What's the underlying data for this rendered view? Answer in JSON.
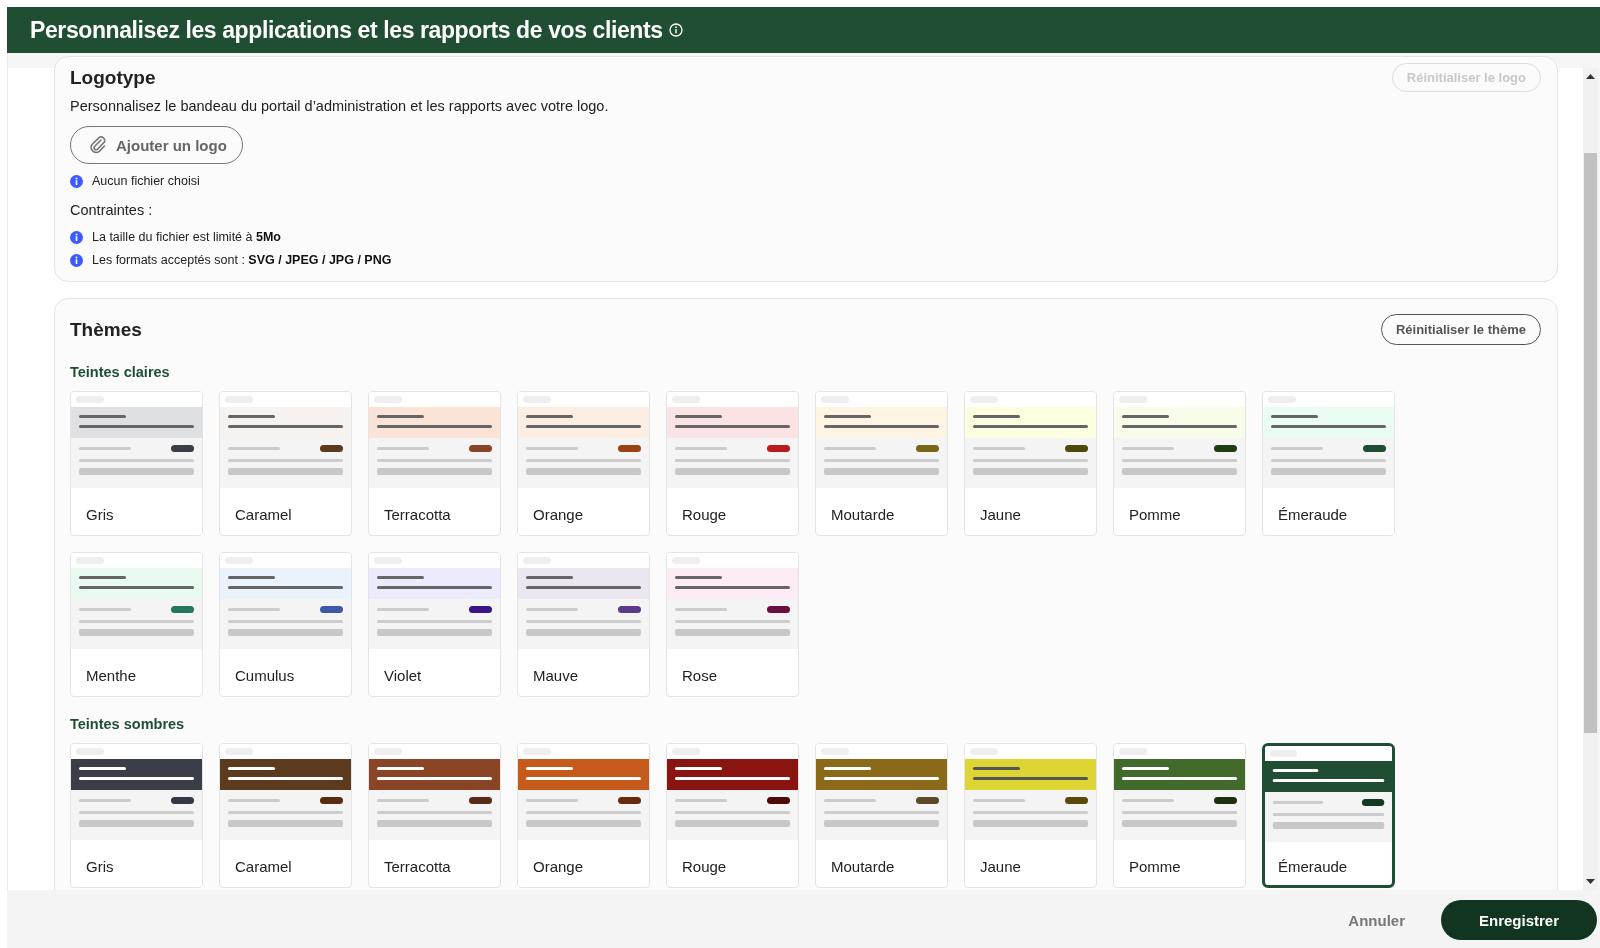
{
  "header": {
    "title": "Personnalisez les applications et les rapports de vos clients"
  },
  "logo_section": {
    "title": "Logotype",
    "reset_button": {
      "label": "Réinitialiser le logo",
      "disabled": true
    },
    "description": "Personnalisez le bandeau du portail d’administration et les rapports avec votre logo.",
    "add_button": {
      "label": "Ajouter un logo"
    },
    "file_status": "Aucun fichier choisi",
    "constraints_label": "Contraintes :",
    "constraints": [
      "La taille du fichier est limité à **5Mo**",
      "Les formats acceptés sont : **SVG / JPEG / JPG / PNG**"
    ]
  },
  "themes": {
    "title": "Thèmes",
    "reset_button": {
      "label": "Réinitialiser le thème",
      "disabled": false
    },
    "groups": [
      {
        "title": "Teintes claires",
        "kind": "light",
        "themes": [
          {
            "name": "Gris",
            "color": "#dfe0e3",
            "pill": {
              "color": "#3a3e47"
            },
            "selected": false
          },
          {
            "name": "Caramel",
            "color": "#f7f2ee",
            "pill": {
              "color": "#5c3a1e"
            },
            "selected": false
          },
          {
            "name": "Terracotta",
            "color": "#fce3d8",
            "pill": {
              "color": "#8a4526"
            },
            "selected": false
          },
          {
            "name": "Orange",
            "color": "#fdeee4",
            "pill": {
              "color": "#9a4212"
            },
            "selected": false
          },
          {
            "name": "Rouge",
            "color": "#fbe3e3",
            "pill": {
              "color": "#b81c1c"
            },
            "selected": false
          },
          {
            "name": "Moutarde",
            "color": "#fdf4e4",
            "pill": {
              "color": "#7a6418"
            },
            "selected": false
          },
          {
            "name": "Jaune",
            "color": "#fdfde0",
            "pill": {
              "color": "#4d4a0a"
            },
            "selected": false
          },
          {
            "name": "Pomme",
            "color": "#f7fde8",
            "pill": {
              "color": "#1f3d10"
            },
            "selected": false
          },
          {
            "name": "Émeraude",
            "color": "#eafdf1",
            "pill": {
              "color": "#1f4e33"
            },
            "selected": false
          },
          {
            "name": "Menthe",
            "color": "#e9fbee",
            "pill": {
              "color": "#25765e"
            },
            "selected": false
          },
          {
            "name": "Cumulus",
            "color": "#eaf2fc",
            "pill": {
              "color": "#3d5aa8"
            },
            "selected": false
          },
          {
            "name": "Violet",
            "color": "#ecebfd",
            "pill": {
              "color": "#3a158a"
            },
            "selected": false
          },
          {
            "name": "Mauve",
            "color": "#ebe6f0",
            "pill": {
              "color": "#5a3a8a"
            },
            "selected": false
          },
          {
            "name": "Rose",
            "color": "#fdebf5",
            "pill": {
              "color": "#6a1040"
            },
            "selected": false
          }
        ]
      },
      {
        "title": "Teintes sombres",
        "kind": "dark",
        "themes": [
          {
            "name": "Gris",
            "color": "#3a3e47",
            "pill": {
              "color": "#333845"
            },
            "selected": false
          },
          {
            "name": "Caramel",
            "color": "#5c3a1e",
            "pill": {
              "color": "#5a2c14"
            },
            "selected": false
          },
          {
            "name": "Terracotta",
            "color": "#8a4526",
            "pill": {
              "color": "#5a2a16"
            },
            "selected": false
          },
          {
            "name": "Orange",
            "color": "#c55a1a",
            "pill": {
              "color": "#6a2a10"
            },
            "selected": false
          },
          {
            "name": "Rouge",
            "color": "#8a1510",
            "pill": {
              "color": "#4d0a08"
            },
            "selected": false
          },
          {
            "name": "Moutarde",
            "color": "#8a6a18",
            "pill": {
              "color": "#5a4a2a"
            },
            "selected": false
          },
          {
            "name": "Jaune",
            "color": "#dcd534",
            "pill": {
              "color": "#5a4a0a"
            },
            "selected": false
          },
          {
            "name": "Pomme",
            "color": "#426a2a",
            "pill": {
              "color": "#1f3010"
            },
            "selected": false
          },
          {
            "name": "Émeraude",
            "color": "#1f4e33",
            "pill": {
              "color": "#143a23"
            },
            "selected": true
          }
        ]
      }
    ]
  },
  "footer": {
    "cancel_button": "Annuler",
    "save_button": "Enregistrer"
  }
}
